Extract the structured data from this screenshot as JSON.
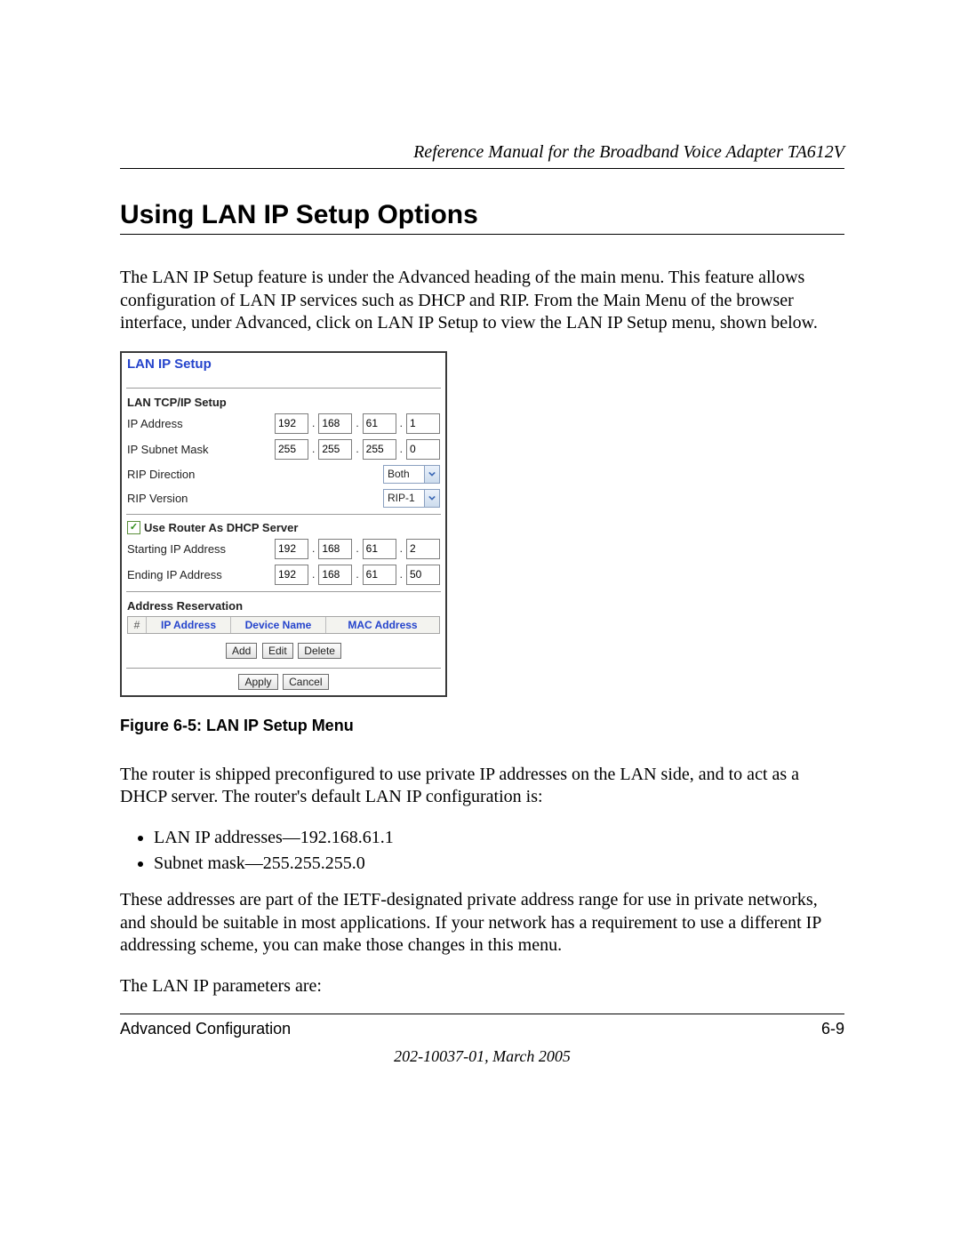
{
  "header": {
    "running_head": "Reference Manual for the Broadband Voice Adapter TA612V"
  },
  "title": "Using LAN IP Setup Options",
  "paragraphs": {
    "p1": "The LAN IP Setup feature is under the Advanced heading of the main menu. This feature allows configuration of LAN IP services such as DHCP and RIP. From the Main Menu of the browser interface, under Advanced, click on LAN IP Setup to view the LAN IP Setup menu, shown below.",
    "figure_caption": "Figure 6-5:  LAN IP Setup Menu",
    "p2": "The router is shipped preconfigured to use private IP addresses on the LAN side, and to act as a DHCP server. The router's default LAN IP configuration is:",
    "b1": "LAN IP addresses—192.168.61.1",
    "b2": "Subnet mask—255.255.255.0",
    "p3": "These addresses are part of the IETF-designated private address range for use in private networks, and should be suitable in most applications. If your network has a requirement to use a different IP addressing scheme, you can make those changes in this menu.",
    "p4": "The LAN IP parameters are:"
  },
  "ui": {
    "panel_title": "LAN IP Setup",
    "sections": {
      "tcpip": "LAN TCP/IP Setup",
      "ip_address_label": "IP Address",
      "ip_address": [
        "192",
        "168",
        "61",
        "1"
      ],
      "subnet_label": "IP Subnet Mask",
      "subnet": [
        "255",
        "255",
        "255",
        "0"
      ],
      "rip_dir_label": "RIP Direction",
      "rip_dir_value": "Both",
      "rip_ver_label": "RIP Version",
      "rip_ver_value": "RIP-1",
      "dhcp_checkbox": "Use Router As DHCP Server",
      "start_ip_label": "Starting IP Address",
      "start_ip": [
        "192",
        "168",
        "61",
        "2"
      ],
      "end_ip_label": "Ending IP Address",
      "end_ip": [
        "192",
        "168",
        "61",
        "50"
      ],
      "reservation": "Address Reservation",
      "cols": {
        "num": "#",
        "ip": "IP Address",
        "dev": "Device Name",
        "mac": "MAC Address"
      },
      "btn": {
        "add": "Add",
        "edit": "Edit",
        "delete": "Delete",
        "apply": "Apply",
        "cancel": "Cancel"
      }
    }
  },
  "footer": {
    "left": "Advanced Configuration",
    "right": "6-9",
    "meta": "202-10037-01, March 2005"
  }
}
